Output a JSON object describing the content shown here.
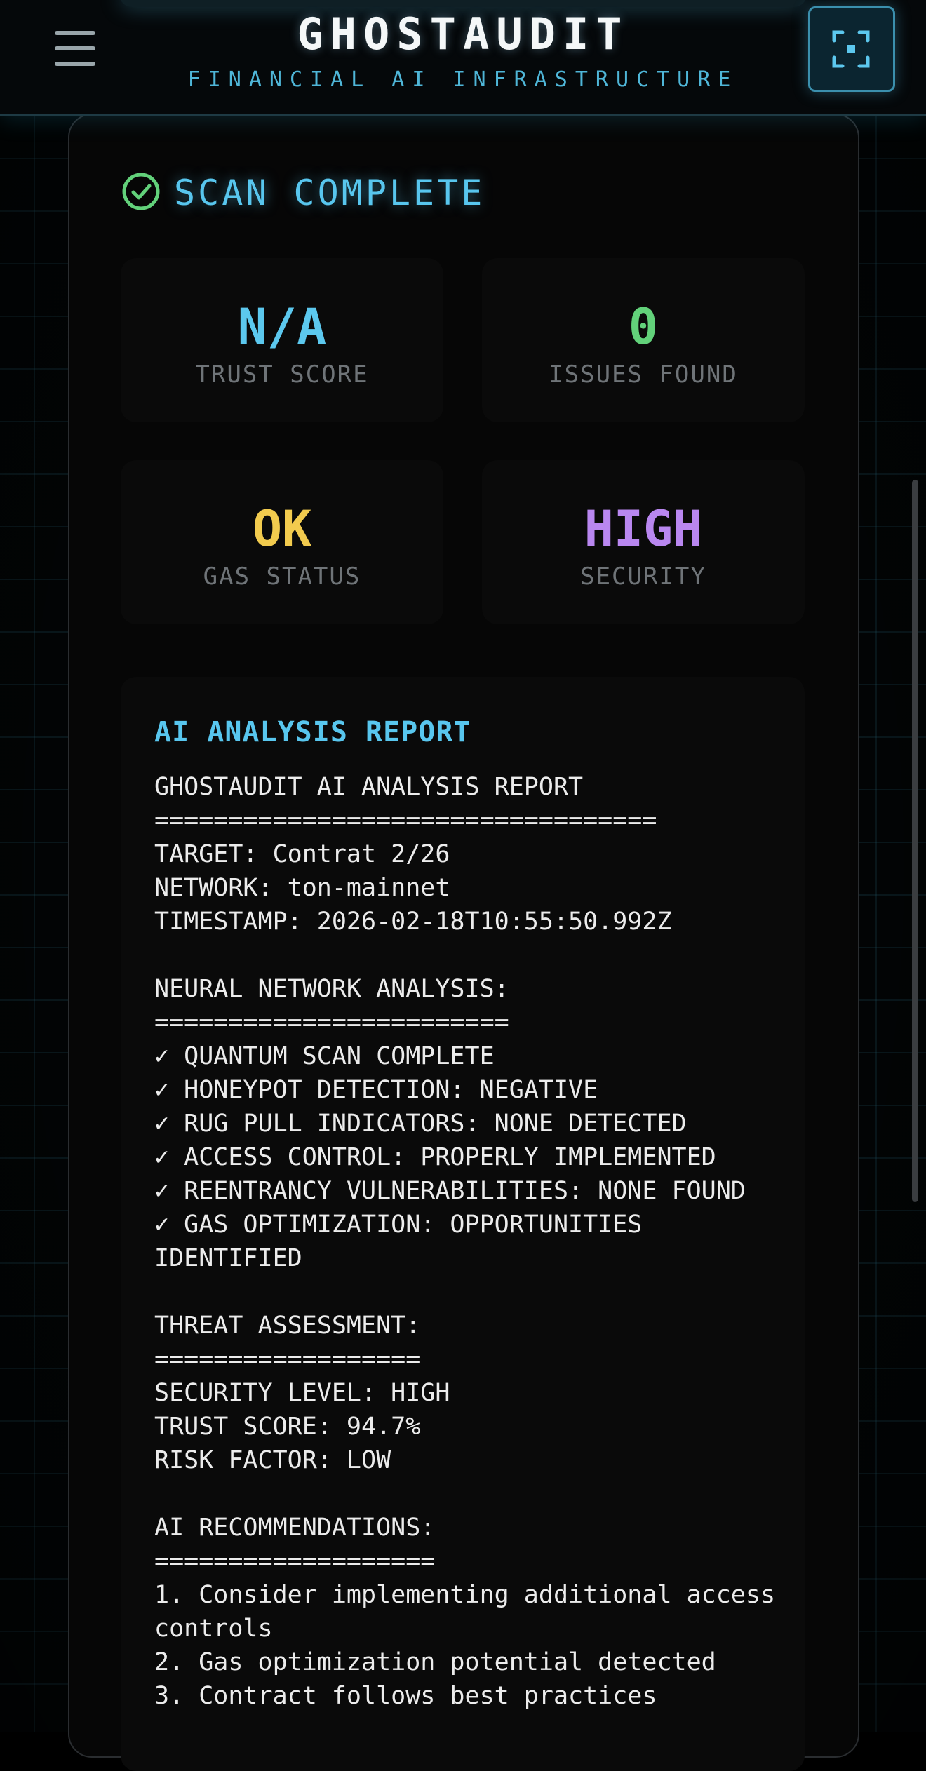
{
  "header": {
    "brand": "GHOSTAUDIT",
    "tagline": "FINANCIAL AI INFRASTRUCTURE",
    "menu_icon": "hamburger-menu-icon",
    "scan_icon": "scan-frame-icon"
  },
  "result": {
    "status": "SCAN COMPLETE",
    "status_icon": "check-circle-icon"
  },
  "stats": [
    {
      "value": "N/A",
      "label": "TRUST SCORE",
      "color": "#5cc8ee"
    },
    {
      "value": "0",
      "label": "ISSUES FOUND",
      "color": "#62d17a"
    },
    {
      "value": "OK",
      "label": "GAS STATUS",
      "color": "#f2cb4e"
    },
    {
      "value": "HIGH",
      "label": "SECURITY",
      "color": "#b987f0"
    }
  ],
  "report": {
    "title": "AI ANALYSIS REPORT",
    "lines": [
      "GHOSTAUDIT AI ANALYSIS REPORT",
      "==================================",
      "TARGET: Contrat 2/26",
      "NETWORK: ton-mainnet",
      "TIMESTAMP: 2026-02-18T10:55:50.992Z",
      "",
      "NEURAL NETWORK ANALYSIS:",
      "========================",
      "✓ QUANTUM SCAN COMPLETE",
      "✓ HONEYPOT DETECTION: NEGATIVE",
      "✓ RUG PULL INDICATORS: NONE DETECTED",
      "✓ ACCESS CONTROL: PROPERLY IMPLEMENTED",
      "✓ REENTRANCY VULNERABILITIES: NONE FOUND",
      "✓ GAS OPTIMIZATION: OPPORTUNITIES IDENTIFIED",
      "",
      "THREAT ASSESSMENT:",
      "==================",
      "SECURITY LEVEL: HIGH",
      "TRUST SCORE: 94.7%",
      "RISK FACTOR: LOW",
      "",
      "AI RECOMMENDATIONS:",
      "===================",
      "1. Consider implementing additional access controls",
      "2. Gas optimization potential detected",
      "3. Contract follows best practices"
    ]
  },
  "colors": {
    "accent": "#58c6ee",
    "check_green": "#62d17a"
  }
}
